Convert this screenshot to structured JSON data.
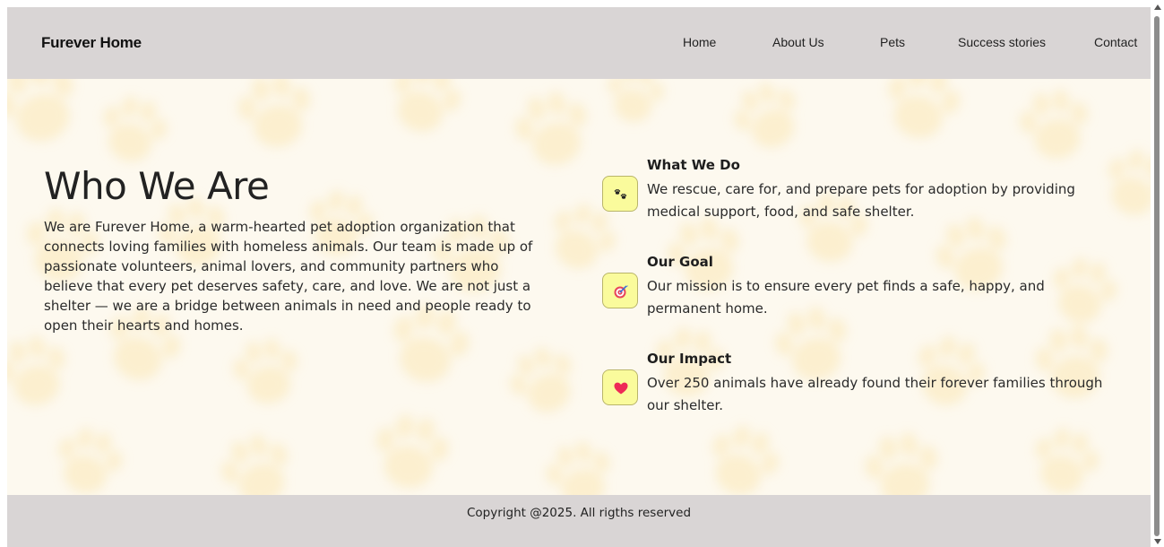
{
  "nav": {
    "brand": "Furever Home",
    "links": [
      "Home",
      "About Us",
      "Pets",
      "Success stories",
      "Contact"
    ]
  },
  "about": {
    "heading": "Who We Are",
    "intro": "We are Furever Home, a warm-hearted pet adoption organization that connects loving families with homeless animals. Our team is made up of passionate volunteers, animal lovers, and community partners who believe that every pet deserves safety, care, and love. We are not just a shelter — we are a bridge between animals in need and people ready to open their hearts and homes."
  },
  "features": [
    {
      "icon": "paw-prints-icon",
      "title": "What We Do",
      "text": "We rescue, care for, and prepare pets for adoption by providing medical support, food, and safe shelter."
    },
    {
      "icon": "target-icon",
      "title": "Our Goal",
      "text": "Our mission is to ensure every pet finds a safe, happy, and permanent home."
    },
    {
      "icon": "heart-icon",
      "title": "Our Impact",
      "text": "Over 250 animals have already found their forever families through our shelter."
    }
  ],
  "footer": {
    "copyright": "Copyright @2025. All rigths reserved"
  },
  "colors": {
    "header_bg": "#d9d5d5",
    "hero_bg": "#fdf9ef",
    "paw_tint": "#fbe7b5",
    "icon_box_bg": "#fafb9c",
    "text": "#222222"
  }
}
